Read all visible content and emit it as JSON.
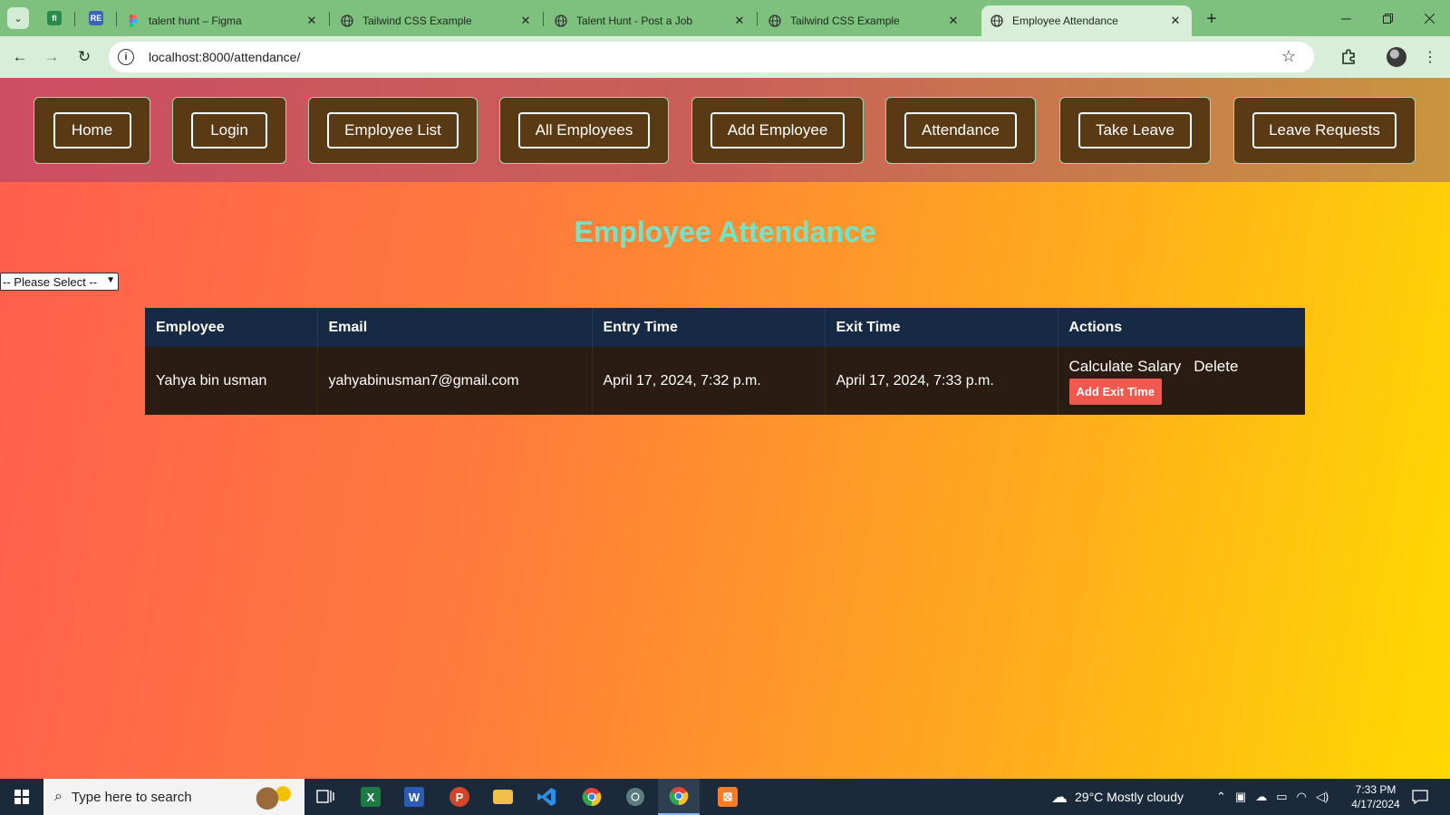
{
  "browser": {
    "tabs": [
      {
        "title": "talent hunt – Figma",
        "active": false
      },
      {
        "title": "Tailwind CSS Example",
        "active": false
      },
      {
        "title": "Talent Hunt - Post a Job",
        "active": false
      },
      {
        "title": "Tailwind CSS Example",
        "active": false
      },
      {
        "title": "Employee Attendance",
        "active": true
      }
    ],
    "pinned_tabs": [
      {
        "label": "fi",
        "color": "#2b8a4a"
      },
      {
        "label": "RE",
        "color": "#3b63b7"
      }
    ],
    "close_glyph": "✕",
    "newtab_glyph": "+",
    "url": "localhost:8000/attendance/"
  },
  "nav": {
    "items": [
      "Home",
      "Login",
      "Employee List",
      "All Employees",
      "Add Employee",
      "Attendance",
      "Take Leave",
      "Leave Requests"
    ]
  },
  "page": {
    "heading": "Employee Attendance",
    "select_value": "-- Please Select --"
  },
  "table": {
    "headers": [
      "Employee",
      "Email",
      "Entry Time",
      "Exit Time",
      "Actions"
    ],
    "rows": [
      {
        "employee": "Yahya bin usman",
        "email": "yahyabinusman7@gmail.com",
        "entry_time": "April 17, 2024, 7:32 p.m.",
        "exit_time": "April 17, 2024, 7:33 p.m.",
        "actions": {
          "calculate": "Calculate Salary",
          "delete": "Delete",
          "add_exit": "Add Exit Time"
        }
      }
    ]
  },
  "taskbar": {
    "search_placeholder": "Type here to search",
    "weather": "29°C  Mostly cloudy",
    "time": "7:33 PM",
    "date": "4/17/2024"
  },
  "colors": {
    "heading": "#73e4c8",
    "nav_card": "#5a3a14",
    "table_header": "#172a45",
    "table_row": "#2a1c12",
    "exit_button": "#f05a4e"
  }
}
